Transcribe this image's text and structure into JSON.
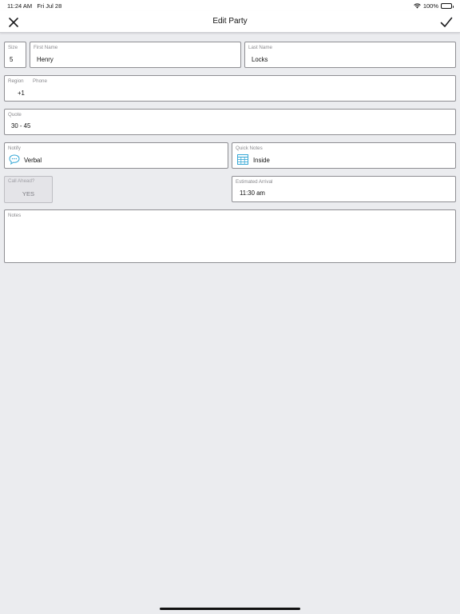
{
  "status_bar": {
    "time": "11:24 AM",
    "date": "Fri Jul 28",
    "battery": "100%"
  },
  "nav": {
    "title": "Edit Party"
  },
  "form": {
    "size": {
      "label": "Size",
      "value": "5"
    },
    "first_name": {
      "label": "First Name",
      "value": "Henry"
    },
    "last_name": {
      "label": "Last Name",
      "value": "Locks"
    },
    "region": {
      "label": "Region",
      "value": "+1"
    },
    "phone": {
      "label": "Phone",
      "value": ""
    },
    "quote": {
      "label": "Quote",
      "value": "30 - 45"
    },
    "notify": {
      "label": "Notify",
      "value": "Verbal",
      "icon": "speech-bubble-icon"
    },
    "quick_notes": {
      "label": "Quick Notes",
      "value": "Inside",
      "icon": "grid-icon"
    },
    "call_ahead": {
      "label": "Call Ahead?",
      "value": "YES"
    },
    "estimated_arrival": {
      "label": "Estimated Arrival",
      "value": "11:30 am"
    },
    "notes": {
      "label": "Notes",
      "value": ""
    }
  },
  "colors": {
    "accent": "#37a8d6",
    "background": "#ebecef",
    "border": "#8e8e93"
  }
}
